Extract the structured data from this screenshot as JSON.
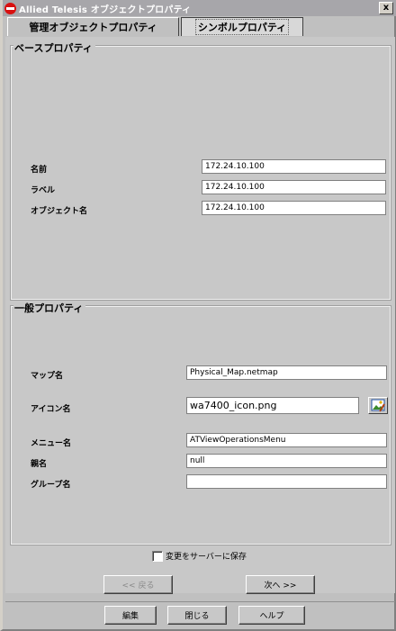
{
  "window": {
    "title": "Allied Telesis オブジェクトプロパティ",
    "close_label": "x"
  },
  "tabs": [
    {
      "label": "管理オブジェクトプロパティ",
      "selected": false
    },
    {
      "label": "シンボルプロパティ",
      "selected": true
    }
  ],
  "base_properties": {
    "title": "ベースプロパティ",
    "fields": [
      {
        "label": "名前",
        "value": "172.24.10.100"
      },
      {
        "label": "ラベル",
        "value": "172.24.10.100"
      },
      {
        "label": "オブジェクト名",
        "value": "172.24.10.100"
      }
    ]
  },
  "general_properties": {
    "title": "一般プロパティ",
    "fields": [
      {
        "label": "マップ名",
        "value": "Physical_Map.netmap"
      },
      {
        "label": "アイコン名",
        "value": "wa7400_icon.png"
      },
      {
        "label": "メニュー名",
        "value": "ATViewOperationsMenu"
      },
      {
        "label": "親名",
        "value": "null"
      },
      {
        "label": "グループ名",
        "value": ""
      }
    ],
    "icon_picker": "image-picker-icon"
  },
  "save_to_server": {
    "label": "変更をサーバーに保存",
    "checked": false
  },
  "nav": {
    "back_label": "<< 戻る",
    "next_label": "次へ >>",
    "back_enabled": false
  },
  "footer": {
    "edit_label": "編集",
    "close_label": "閉じる",
    "help_label": "ヘルプ"
  },
  "colors": {
    "titlebar": "#a7a6aa",
    "panel": "#c8c8c8",
    "app_icon": "#d81010"
  }
}
